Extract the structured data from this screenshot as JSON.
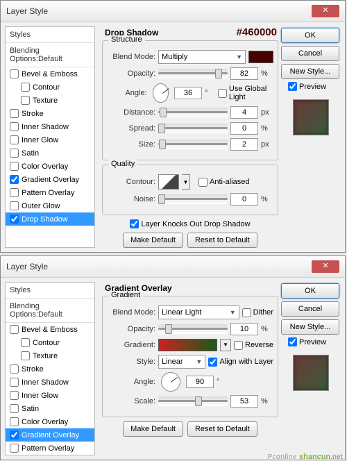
{
  "dialog1": {
    "title": "Layer Style",
    "color_annot": "#460000",
    "styles_header": "Styles",
    "blending_header": "Blending Options:Default",
    "items": [
      {
        "label": "Bevel & Emboss",
        "checked": false,
        "indent": false
      },
      {
        "label": "Contour",
        "checked": false,
        "indent": true
      },
      {
        "label": "Texture",
        "checked": false,
        "indent": true
      },
      {
        "label": "Stroke",
        "checked": false,
        "indent": false
      },
      {
        "label": "Inner Shadow",
        "checked": false,
        "indent": false
      },
      {
        "label": "Inner Glow",
        "checked": false,
        "indent": false
      },
      {
        "label": "Satin",
        "checked": false,
        "indent": false
      },
      {
        "label": "Color Overlay",
        "checked": false,
        "indent": false
      },
      {
        "label": "Gradient Overlay",
        "checked": true,
        "indent": false
      },
      {
        "label": "Pattern Overlay",
        "checked": false,
        "indent": false
      },
      {
        "label": "Outer Glow",
        "checked": false,
        "indent": false
      },
      {
        "label": "Drop Shadow",
        "checked": true,
        "indent": false,
        "selected": true
      }
    ],
    "section_title": "Drop Shadow",
    "structure_label": "Structure",
    "quality_label": "Quality",
    "blend_mode_label": "Blend Mode:",
    "blend_mode_value": "Multiply",
    "swatch_color": "#460000",
    "opacity_label": "Opacity:",
    "opacity_value": "82",
    "opacity_unit": "%",
    "angle_label": "Angle:",
    "angle_value": "36",
    "angle_unit": "°",
    "global_light": "Use Global Light",
    "distance_label": "Distance:",
    "distance_value": "4",
    "distance_unit": "px",
    "spread_label": "Spread:",
    "spread_value": "0",
    "spread_unit": "%",
    "size_label": "Size:",
    "size_value": "2",
    "size_unit": "px",
    "contour_label": "Contour:",
    "antialiased": "Anti-aliased",
    "noise_label": "Noise:",
    "noise_value": "0",
    "noise_unit": "%",
    "knocks_out": "Layer Knocks Out Drop Shadow",
    "make_default": "Make Default",
    "reset_default": "Reset to Default",
    "buttons": {
      "ok": "OK",
      "cancel": "Cancel",
      "new_style": "New Style...",
      "preview": "Preview"
    }
  },
  "dialog2": {
    "title": "Layer Style",
    "styles_header": "Styles",
    "blending_header": "Blending Options:Default",
    "items": [
      {
        "label": "Bevel & Emboss",
        "checked": false,
        "indent": false
      },
      {
        "label": "Contour",
        "checked": false,
        "indent": true
      },
      {
        "label": "Texture",
        "checked": false,
        "indent": true
      },
      {
        "label": "Stroke",
        "checked": false,
        "indent": false
      },
      {
        "label": "Inner Shadow",
        "checked": false,
        "indent": false
      },
      {
        "label": "Inner Glow",
        "checked": false,
        "indent": false
      },
      {
        "label": "Satin",
        "checked": false,
        "indent": false
      },
      {
        "label": "Color Overlay",
        "checked": false,
        "indent": false
      },
      {
        "label": "Gradient Overlay",
        "checked": true,
        "indent": false,
        "selected": true
      },
      {
        "label": "Pattern Overlay",
        "checked": false,
        "indent": false
      }
    ],
    "section_title": "Gradient Overlay",
    "gradient_label": "Gradient",
    "blend_mode_label": "Blend Mode:",
    "blend_mode_value": "Linear Light",
    "dither": "Dither",
    "opacity_label": "Opacity:",
    "opacity_value": "10",
    "opacity_unit": "%",
    "gradient_field_label": "Gradient:",
    "reverse": "Reverse",
    "style_label": "Style:",
    "style_value": "Linear",
    "align_layer": "Align with Layer",
    "angle_label": "Angle:",
    "angle_value": "90",
    "angle_unit": "°",
    "scale_label": "Scale:",
    "scale_value": "53",
    "scale_unit": "%",
    "make_default": "Make Default",
    "reset_default": "Reset to Default",
    "buttons": {
      "ok": "OK",
      "cancel": "Cancel",
      "new_style": "New Style...",
      "preview": "Preview"
    }
  },
  "watermark": {
    "main": "shancun",
    "suffix": ".net",
    "extra": "Pconline"
  }
}
